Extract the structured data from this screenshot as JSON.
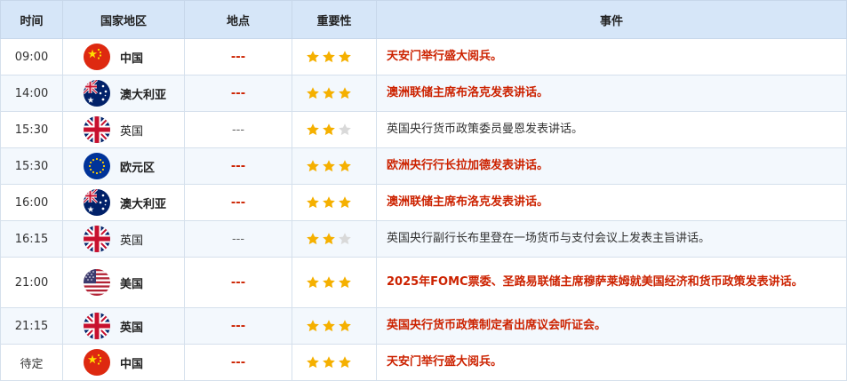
{
  "header": {
    "time": "时间",
    "country": "国家地区",
    "location": "地点",
    "importance": "重要性",
    "event": "事件"
  },
  "colors": {
    "header_bg": "#d6e6f8",
    "alt_row_bg": "#f3f8fd",
    "highlight_text": "#cc2200",
    "star_on": "#f5b000",
    "star_off": "#d9d9d9"
  },
  "rows": [
    {
      "time": "09:00",
      "flag": "cn-flag-icon",
      "country": "中国",
      "location": "---",
      "stars": 3,
      "event": "天安门举行盛大阅兵。",
      "high": true
    },
    {
      "time": "14:00",
      "flag": "au-flag-icon",
      "country": "澳大利亚",
      "location": "---",
      "stars": 3,
      "event": "澳洲联储主席布洛克发表讲话。",
      "high": true
    },
    {
      "time": "15:30",
      "flag": "uk-flag-icon",
      "country": "英国",
      "location": "---",
      "stars": 2,
      "event": "英国央行货币政策委员曼恩发表讲话。",
      "high": false
    },
    {
      "time": "15:30",
      "flag": "eu-flag-icon",
      "country": "欧元区",
      "location": "---",
      "stars": 3,
      "event": "欧洲央行行长拉加德发表讲话。",
      "high": true
    },
    {
      "time": "16:00",
      "flag": "au-flag-icon",
      "country": "澳大利亚",
      "location": "---",
      "stars": 3,
      "event": "澳洲联储主席布洛克发表讲话。",
      "high": true
    },
    {
      "time": "16:15",
      "flag": "uk-flag-icon",
      "country": "英国",
      "location": "---",
      "stars": 2,
      "event": "英国央行副行长布里登在一场货币与支付会议上发表主旨讲话。",
      "high": false
    },
    {
      "time": "21:00",
      "flag": "us-flag-icon",
      "country": "美国",
      "location": "---",
      "stars": 3,
      "event": "2025年FOMC票委、圣路易联储主席穆萨莱姆就美国经济和货币政策发表讲话。",
      "high": true
    },
    {
      "time": "21:15",
      "flag": "uk-flag-icon",
      "country": "英国",
      "location": "---",
      "stars": 3,
      "event": "英国央行货币政策制定者出席议会听证会。",
      "high": true
    },
    {
      "time": "待定",
      "flag": "cn-flag-icon",
      "country": "中国",
      "location": "---",
      "stars": 3,
      "event": "天安门举行盛大阅兵。",
      "high": true
    }
  ]
}
